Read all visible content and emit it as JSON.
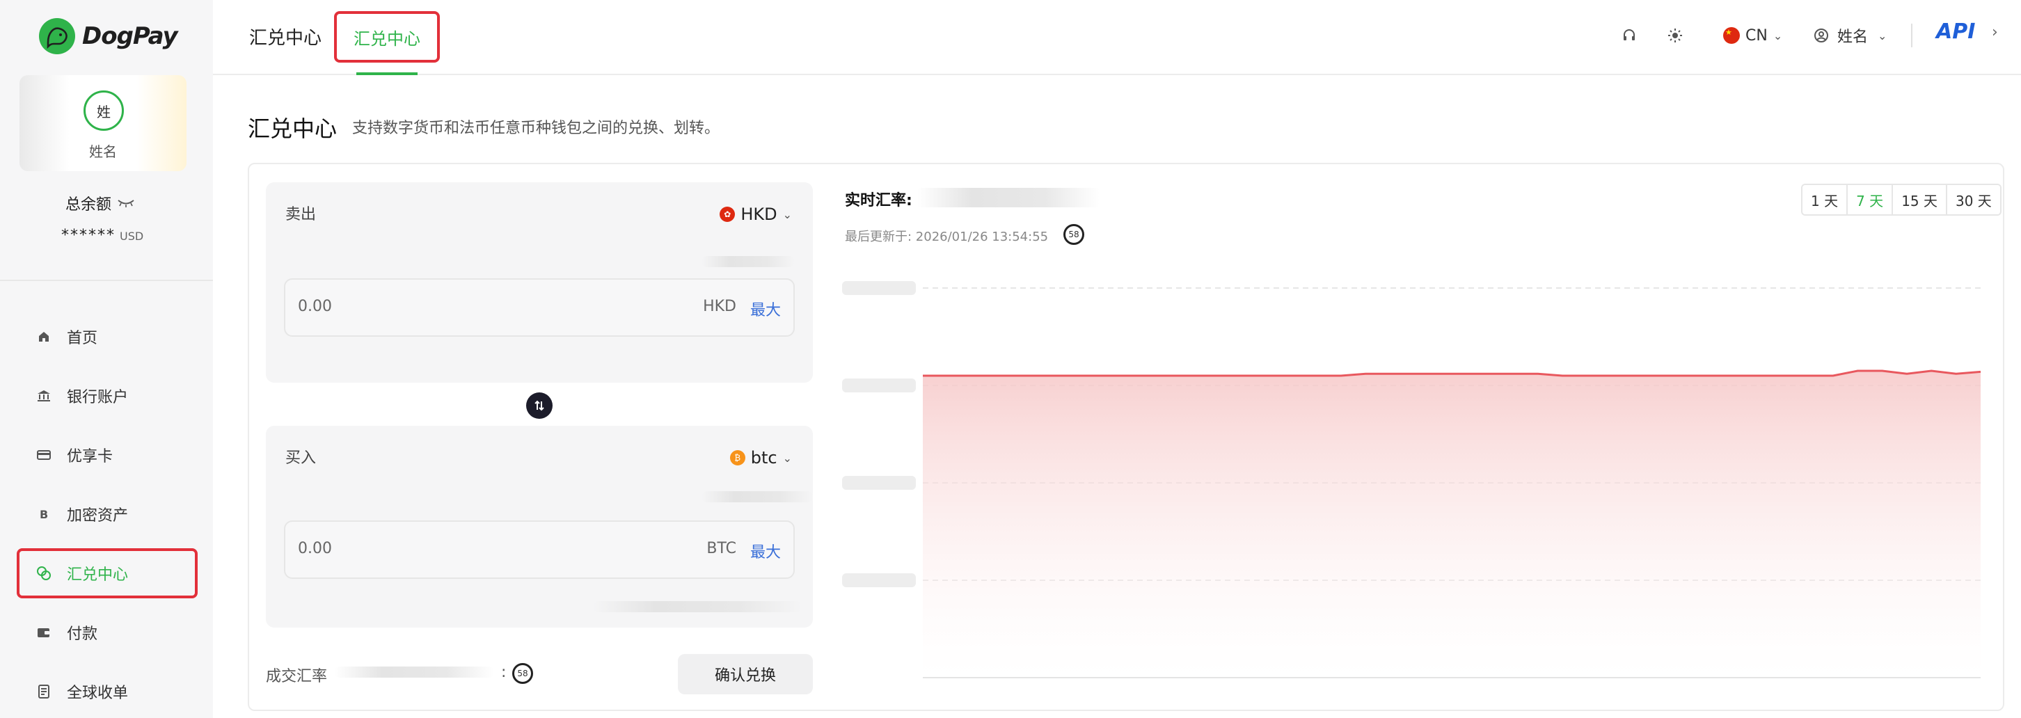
{
  "app": {
    "brand": "DogPay",
    "colors": {
      "accent": "#2fb34a",
      "highlight": "#e2303a",
      "link": "#3a6fd8",
      "chart_line": "#e8585e"
    }
  },
  "sidebar": {
    "avatar_text": "姓",
    "user_name": "姓名",
    "balance_label": "总余额",
    "balance_masked": "******",
    "balance_unit": "USD",
    "nav": [
      {
        "label": "首页",
        "icon": "home-icon",
        "active": false
      },
      {
        "label": "银行账户",
        "icon": "bank-icon",
        "active": false
      },
      {
        "label": "优享卡",
        "icon": "card-icon",
        "active": false
      },
      {
        "label": "加密资产",
        "icon": "bitcoin-icon",
        "active": false
      },
      {
        "label": "汇兑中心",
        "icon": "exchange-icon",
        "active": true
      },
      {
        "label": "付款",
        "icon": "wallet-icon",
        "active": false
      },
      {
        "label": "全球收单",
        "icon": "receipt-icon",
        "active": false
      }
    ]
  },
  "header": {
    "tabs": [
      {
        "label": "汇兑中心",
        "active": false
      },
      {
        "label": "汇兑中心",
        "active": true
      }
    ],
    "language": "CN",
    "user_name": "姓名",
    "api_label": "API"
  },
  "page": {
    "title": "汇兑中心",
    "subtitle": "支持数字货币和法币任意币种钱包之间的兑换、划转。"
  },
  "exchange": {
    "sell": {
      "label": "卖出",
      "currency": "HKD",
      "amount": "0.00",
      "amount_currency": "HKD",
      "max_label": "最大"
    },
    "buy": {
      "label": "买入",
      "currency": "btc",
      "amount": "0.00",
      "amount_currency": "BTC",
      "max_label": "最大"
    },
    "rate_label": "成交汇率",
    "rate_colon": ":",
    "countdown": "58",
    "confirm_label": "确认兑换"
  },
  "chart_panel": {
    "title": "实时汇率:",
    "updated": "最后更新于: 2026/01/26 13:54:55",
    "countdown": "58",
    "ranges": [
      {
        "label": "1 天",
        "active": false
      },
      {
        "label": "7 天",
        "active": true
      },
      {
        "label": "15 天",
        "active": false
      },
      {
        "label": "30 天",
        "active": false
      }
    ]
  },
  "chart_data": {
    "type": "area",
    "title": "",
    "xlabel": "",
    "ylabel": "",
    "grid": true,
    "ylim": [
      0,
      4
    ],
    "y_ticks_visible": false,
    "series": [
      {
        "values": [
          3.1,
          3.1,
          3.1,
          3.1,
          3.1,
          3.1,
          3.1,
          3.1,
          3.1,
          3.1,
          3.1,
          3.1,
          3.1,
          3.1,
          3.1,
          3.1,
          3.1,
          3.1,
          3.12,
          3.12,
          3.12,
          3.12,
          3.12,
          3.12,
          3.12,
          3.12,
          3.1,
          3.1,
          3.1,
          3.1,
          3.1,
          3.1,
          3.1,
          3.1,
          3.1,
          3.1,
          3.1,
          3.1,
          3.15,
          3.15,
          3.12,
          3.15,
          3.12,
          3.14
        ]
      }
    ]
  }
}
